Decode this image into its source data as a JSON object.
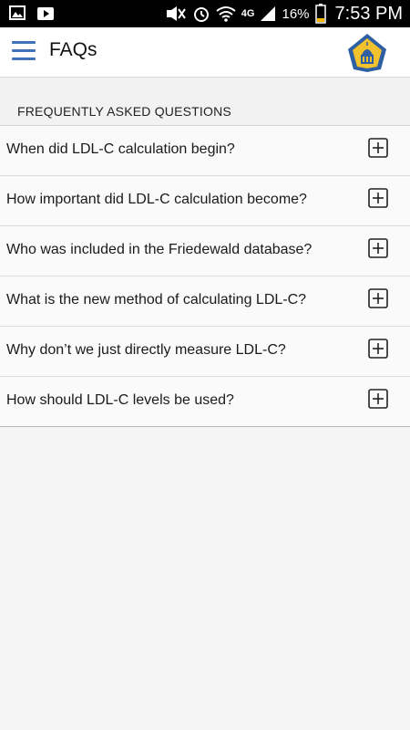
{
  "status_bar": {
    "battery_percent": "16%",
    "time": "7:53 PM",
    "network": "4G",
    "icons": [
      "gallery-icon",
      "play-store-icon",
      "mute-icon",
      "alarm-icon",
      "wifi-icon",
      "signal-icon",
      "battery-icon"
    ]
  },
  "app_bar": {
    "title": "FAQs",
    "menu_icon": "hamburger-menu-icon",
    "logo_icon": "hospital-dome-shield-logo",
    "colors": {
      "menu": "#3f72b8",
      "logo_blue": "#2e5fa3",
      "logo_gold": "#f2c12e"
    }
  },
  "section": {
    "title": "FREQUENTLY ASKED QUESTIONS"
  },
  "faqs": [
    {
      "question": "When did LDL-C calculation begin?"
    },
    {
      "question": "How important did LDL-C calculation become?"
    },
    {
      "question": "Who was included in the Friedewald database?"
    },
    {
      "question": "What is the new method of calculating LDL-C?"
    },
    {
      "question": "Why don’t we just directly measure LDL-C?"
    },
    {
      "question": "How should LDL-C levels be used?"
    }
  ],
  "expand_icon": "plus-square-icon"
}
